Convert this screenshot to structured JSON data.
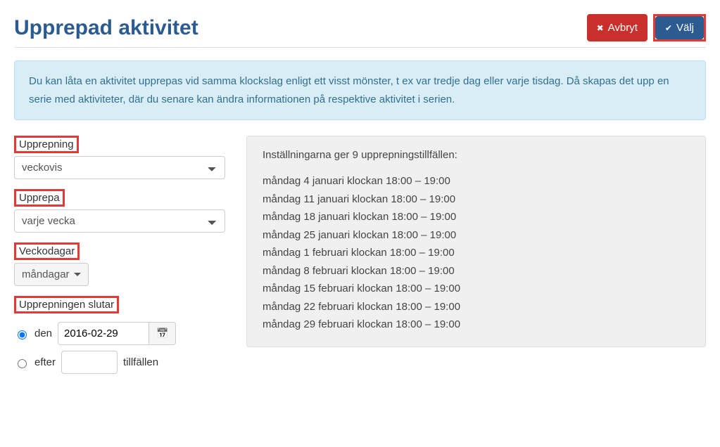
{
  "header": {
    "title": "Upprepad aktivitet",
    "cancel_label": "Avbryt",
    "select_label": "Välj"
  },
  "info": {
    "text": "Du kan låta en aktivitet upprepas vid samma klockslag enligt ett visst mönster, t ex var tredje dag eller varje tisdag. Då skapas det upp en serie med aktiviteter, där du senare kan ändra informationen på respektive aktivitet i serien."
  },
  "form": {
    "repetition_label": "Upprepning",
    "repetition_value": "veckovis",
    "repeat_label": "Upprepa",
    "repeat_value": "varje vecka",
    "weekdays_label": "Veckodagar",
    "weekdays_value": "måndagar",
    "ends_label": "Upprepningen slutar",
    "end_date_radio": "den",
    "end_date_value": "2016-02-29",
    "end_after_radio": "efter",
    "end_after_suffix": "tillfällen",
    "end_after_value": ""
  },
  "preview": {
    "heading": "Inställningarna ger 9 upprepningstillfällen:",
    "items": [
      "måndag 4 januari klockan 18:00 – 19:00",
      "måndag 11 januari klockan 18:00 – 19:00",
      "måndag 18 januari klockan 18:00 – 19:00",
      "måndag 25 januari klockan 18:00 – 19:00",
      "måndag 1 februari klockan 18:00 – 19:00",
      "måndag 8 februari klockan 18:00 – 19:00",
      "måndag 15 februari klockan 18:00 – 19:00",
      "måndag 22 februari klockan 18:00 – 19:00",
      "måndag 29 februari klockan 18:00 – 19:00"
    ]
  }
}
